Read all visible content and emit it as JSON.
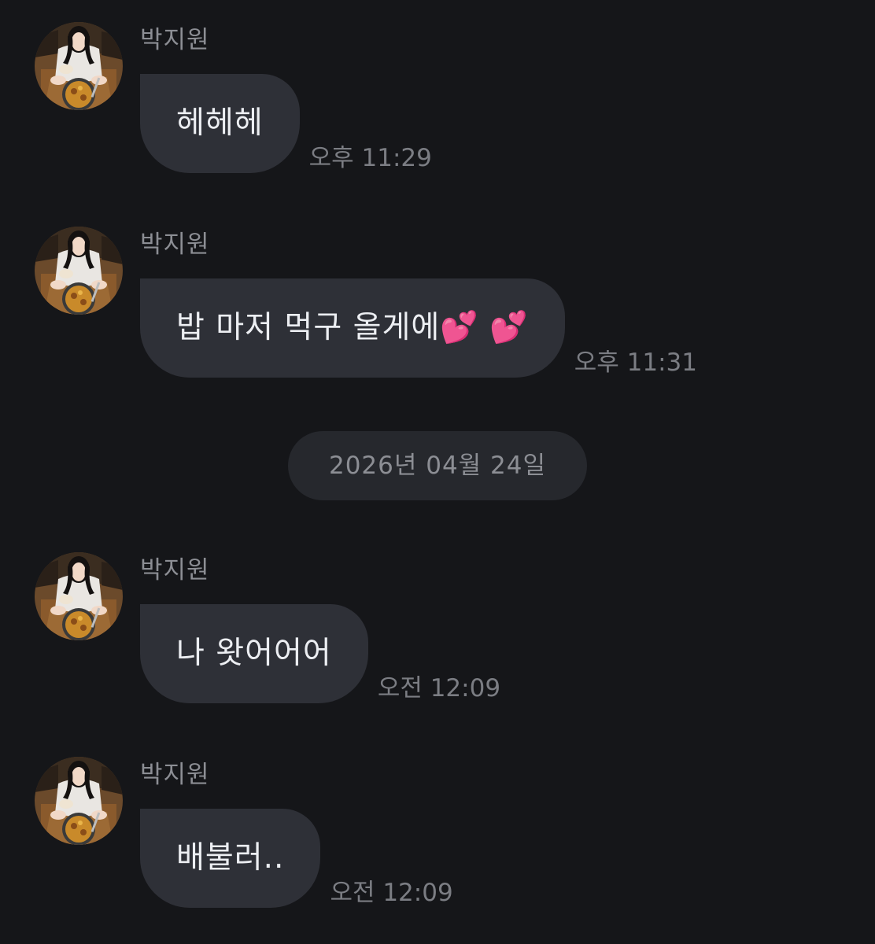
{
  "messages": [
    {
      "sender": "박지원",
      "text": "헤헤헤",
      "time": "오후 11:29"
    },
    {
      "sender": "박지원",
      "text": "밥 마저 먹구 올게에💕 💕",
      "time": "오후 11:31"
    },
    {
      "sender": "박지원",
      "text": "나 왓어어어",
      "time": "오전 12:09"
    },
    {
      "sender": "박지원",
      "text": "배불러..",
      "time": "오전 12:09"
    }
  ],
  "date_divider": "2026년 04월 24일",
  "colors": {
    "background": "#151619",
    "bubble": "#2e3037",
    "date_pill": "#26282d",
    "text": "#eceef2",
    "muted": "#8c8e94"
  }
}
